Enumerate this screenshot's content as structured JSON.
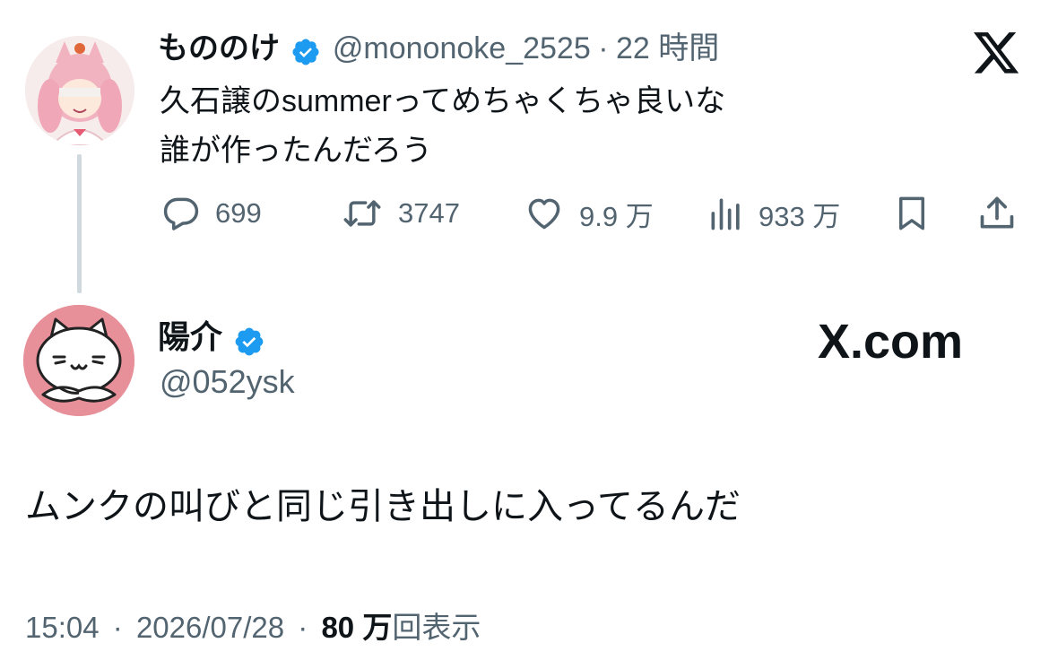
{
  "original_tweet": {
    "display_name": "もののけ",
    "handle": "@mononoke_2525",
    "separator": "·",
    "time_ago": "22 時間",
    "text_line1": "久石譲のsummerってめちゃくちゃ良いな",
    "text_line2": "誰が作ったんだろう",
    "avatar_icon": "anime-girl-avatar",
    "actions": {
      "replies": "699",
      "reposts": "3747",
      "likes": "9.9 万",
      "views": "933 万"
    }
  },
  "reply_tweet": {
    "display_name": "陽介",
    "handle": "@052ysk",
    "avatar_icon": "white-cat-avatar",
    "text": "ムンクの叫びと同じ引き出しに入ってるんだ",
    "watermark": "X.com",
    "footer": {
      "time": "15:04",
      "dot1": "·",
      "date": "2026/07/28",
      "dot2": "·",
      "view_count": "80 万",
      "view_label": "回表示"
    }
  },
  "colors": {
    "verified_blue": "#1d9bf0",
    "secondary_text": "#536471",
    "thread_line": "#cfd9de",
    "cat_avatar_bg": "#e8909a"
  }
}
